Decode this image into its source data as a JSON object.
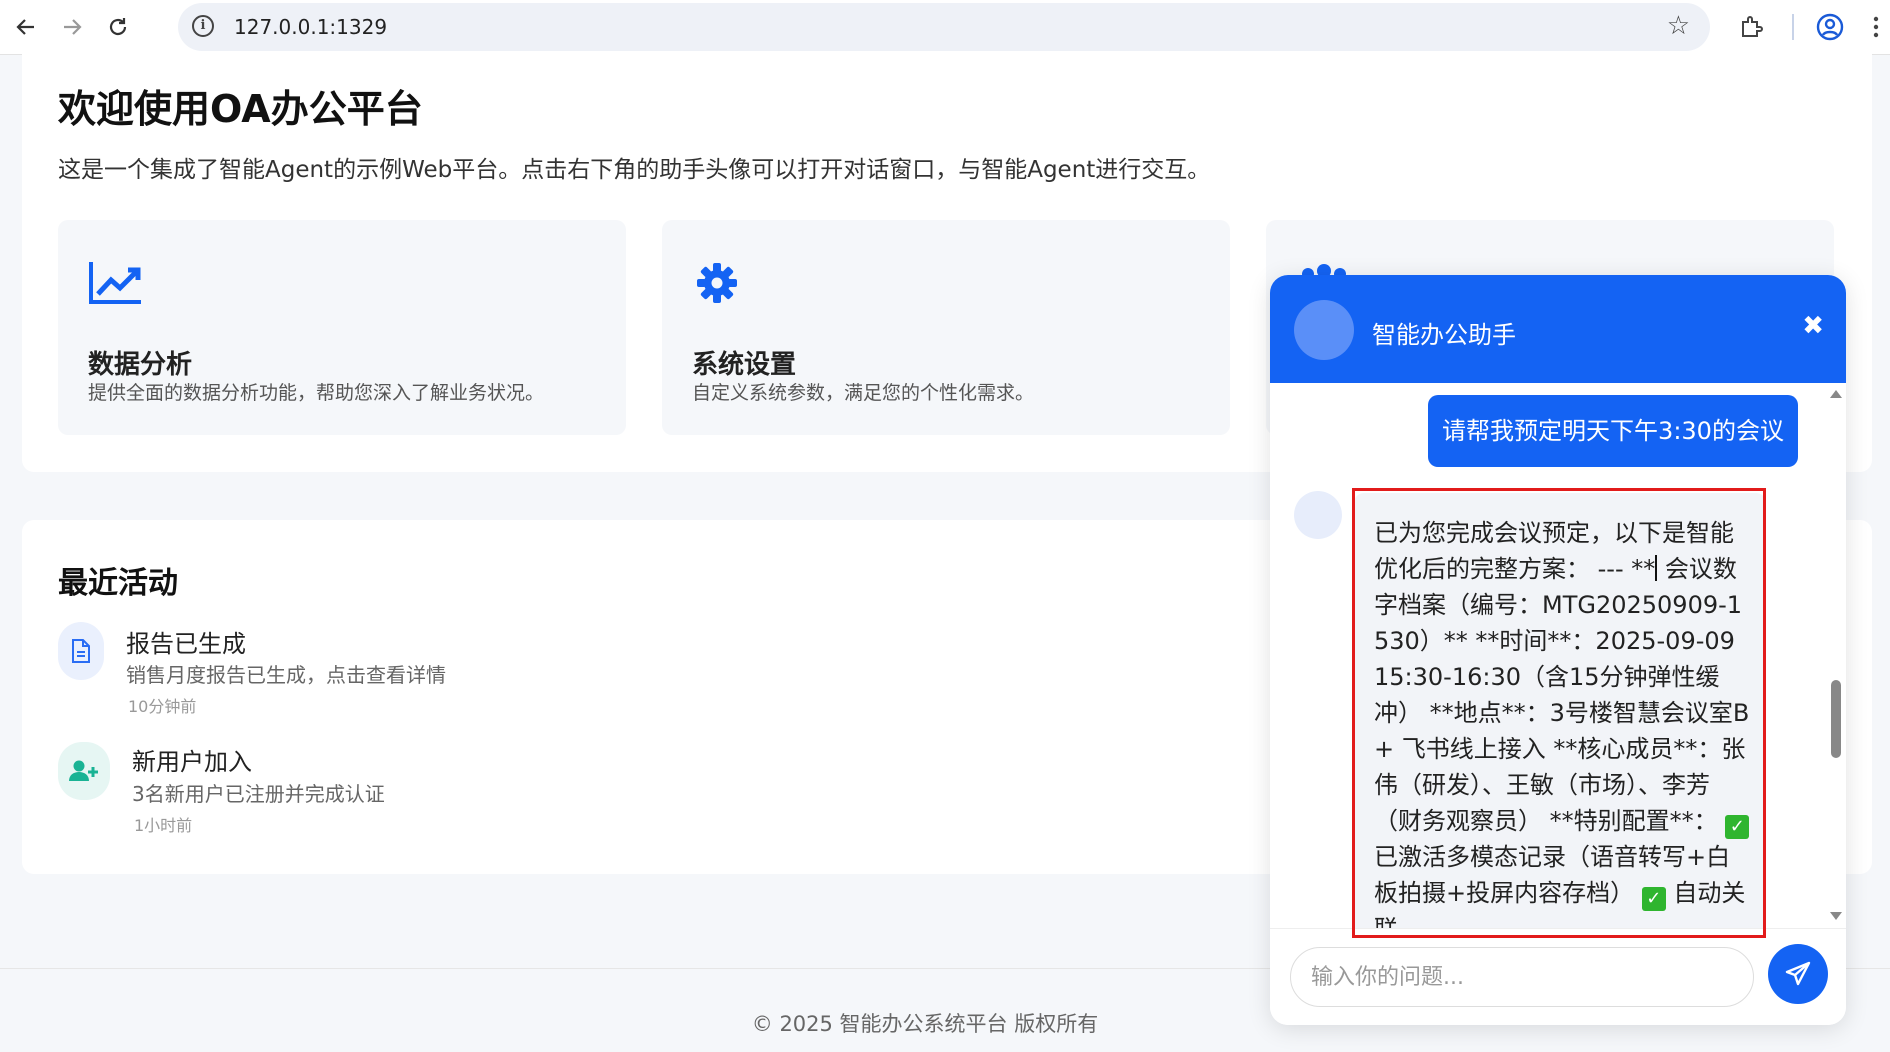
{
  "browser": {
    "url": "127.0.0.1:1329",
    "colors": {
      "omnibox": "#eef1f7",
      "icon": "#444444",
      "profile": "#1a5ad7"
    }
  },
  "page": {
    "title": "欢迎使用OA办公平台",
    "intro": "这是一个集成了智能Agent的示例Web平台。点击右下角的助手头像可以打开对话窗口，与智能Agent进行交互。",
    "features": [
      {
        "icon": "chart-line-icon",
        "title": "数据分析",
        "desc": "提供全面的数据分析功能，帮助您深入了解业务状况。"
      },
      {
        "icon": "gear-icon",
        "title": "系统设置",
        "desc": "自定义系统参数，满足您的个性化需求。"
      },
      {
        "icon": "users-icon",
        "title": "",
        "desc": ""
      }
    ],
    "accent": "#1463f3"
  },
  "activity": {
    "title": "最近活动",
    "items": [
      {
        "icon": "document-icon",
        "title": "报告已生成",
        "desc": "销售月度报告已生成，点击查看详情",
        "time": "10分钟前",
        "icon_bg": "#eaf0fd",
        "icon_color": "#2a6df4"
      },
      {
        "icon": "user-plus-icon",
        "title": "新用户加入",
        "desc": "3名新用户已注册并完成认证",
        "time": "1小时前",
        "icon_bg": "#e6f6f3",
        "icon_color": "#19b394"
      }
    ]
  },
  "footer": {
    "text": "© 2025 智能办公系统平台 版权所有"
  },
  "chat": {
    "title": "智能办公助手",
    "close_label": "✖",
    "user_message": "请帮我预定明天下午3:30的会议",
    "bot_message_part1": "已为您完成会议预定，以下是智能优化后的完整方案： --- **",
    "bot_message_part2": " 会议数字档案（编号：MTG20250909-1530）** **时间**：2025-09-09 15:30-16:30（含15分钟弹性缓冲） **地点**：3号楼智慧会议室B + 飞书线上接入 **核心成员**：张伟（研发）、王敏（市场）、李芳（财务观察员） **特别配置**：",
    "bot_message_part3": " 已激活多模态记录（语音转写+白板拍摄+投屏内容存档）",
    "bot_message_part4": " 自动关联",
    "input_placeholder": "输入你的问题...",
    "header_color": "#1463f3",
    "highlight_color": "#e21b1b"
  }
}
